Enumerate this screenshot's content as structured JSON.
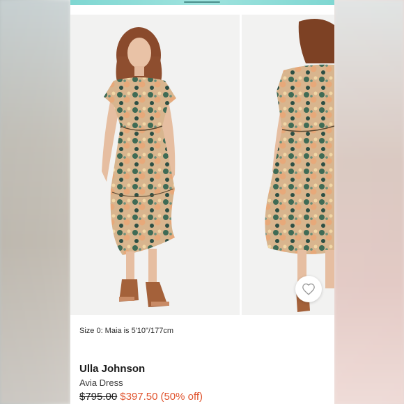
{
  "product": {
    "size_note": "Size 0: Maia is 5'10\"/177cm",
    "brand": "Ulla Johnson",
    "name": "Avia Dress",
    "original_price": "$795.00",
    "sale_price": "$397.50",
    "discount": "(50% off)"
  },
  "gallery": {
    "images": [
      "model-front-photo",
      "model-back-photo"
    ],
    "wishlist_icon": "heart-icon"
  },
  "colors": {
    "sale": "#e0542e",
    "top_bar": "#9fe3de"
  }
}
